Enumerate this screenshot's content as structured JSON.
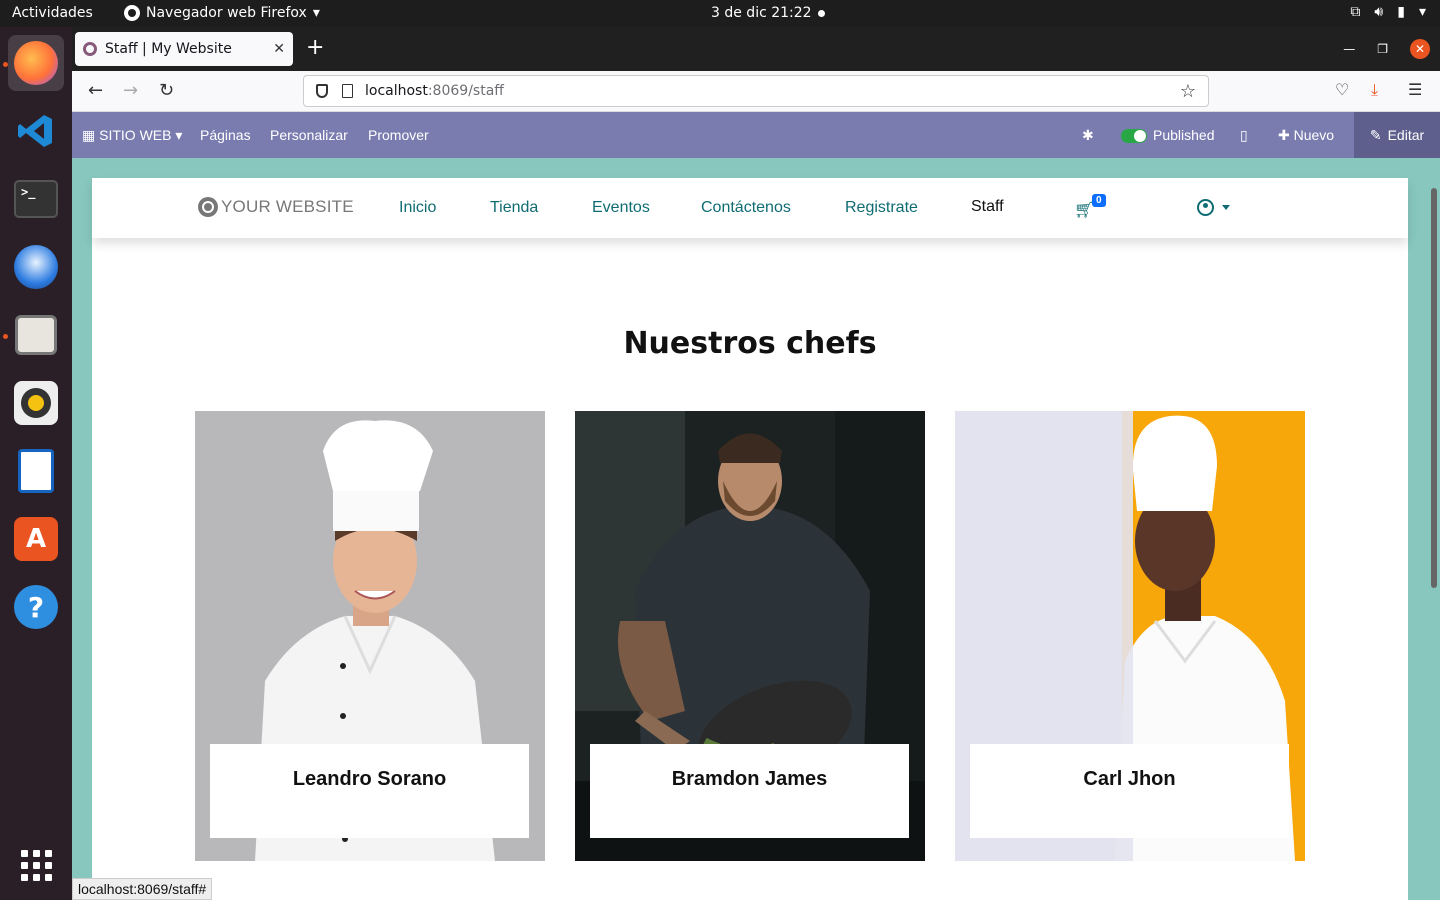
{
  "topbar": {
    "activities": "Actividades",
    "app_name": "Navegador web Firefox",
    "clock": "3 de dic  21:22"
  },
  "dock": {
    "items": [
      "firefox-icon",
      "vscode-icon",
      "terminal-icon",
      "thunderbird-icon",
      "files-icon",
      "rhythmbox-icon",
      "writer-icon",
      "software-icon",
      "help-icon",
      "apps-grid-icon"
    ]
  },
  "browser": {
    "tab_title": "Staff | My Website",
    "url_host": "localhost",
    "url_path": ":8069/staff",
    "status_url": "localhost:8069/staff#"
  },
  "odoo_bar": {
    "website_menu": "SITIO WEB",
    "pages": "Páginas",
    "customize": "Personalizar",
    "promote": "Promover",
    "published": "Published",
    "new": "Nuevo",
    "edit": "Editar"
  },
  "site": {
    "logo": "YOUR WEBSITE",
    "menu": [
      "Inicio",
      "Tienda",
      "Eventos",
      "Contáctenos",
      "Registrate",
      "Staff"
    ],
    "active_menu": "Staff",
    "cart_count": "0",
    "heading": "Nuestros chefs",
    "chefs": [
      {
        "name": "Leandro Sorano"
      },
      {
        "name": "Bramdon James"
      },
      {
        "name": "Carl Jhon"
      }
    ]
  },
  "colors": {
    "odoo_bar": "#7a7cb0",
    "edit_button": "#5e5f8d",
    "canvas_bg": "#87c7be",
    "menu_link": "#0f6c73",
    "dock_bg": "#2b1f27",
    "accent_orange": "#e95420"
  }
}
